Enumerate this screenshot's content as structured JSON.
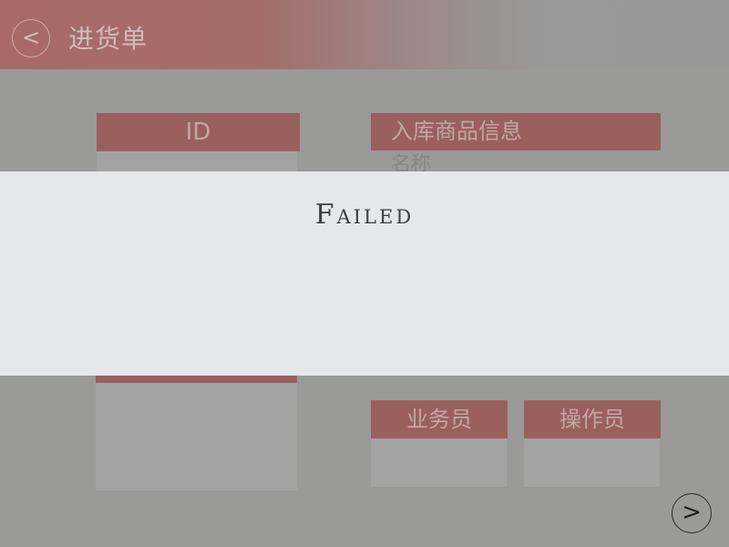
{
  "header": {
    "back_glyph": "<",
    "title": "进货单"
  },
  "id_panel": {
    "header": "ID"
  },
  "goods_panel": {
    "header": "入库商品信息",
    "name_label": "名称"
  },
  "salesperson_panel": {
    "header": "业务员"
  },
  "operator_panel": {
    "header": "操作员"
  },
  "next_glyph": ">",
  "modal": {
    "message": "Failed"
  },
  "colors": {
    "accent": "#9a605e",
    "overlay": "#9a9a99",
    "modal_bg": "#e6e7e9"
  }
}
